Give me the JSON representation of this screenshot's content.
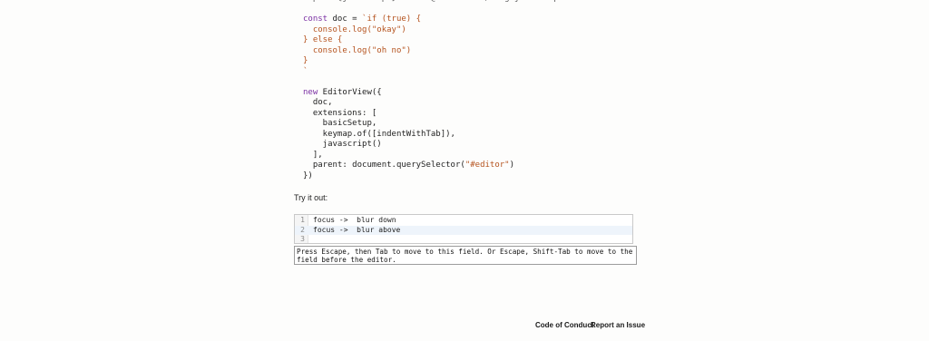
{
  "code_lines": [
    {
      "segments": [
        {
          "t": "import {javascript} from \"@codemirror/lang-javascript\"",
          "c": "cut"
        }
      ]
    },
    {
      "segments": [
        {
          "t": "",
          "c": ""
        }
      ]
    },
    {
      "segments": [
        {
          "t": "const",
          "c": "kw"
        },
        {
          "t": " doc = ",
          "c": ""
        },
        {
          "t": "`if (true) {",
          "c": "str"
        }
      ]
    },
    {
      "segments": [
        {
          "t": "  console.log(\"okay\")",
          "c": "str"
        }
      ]
    },
    {
      "segments": [
        {
          "t": "} else {",
          "c": "str"
        }
      ]
    },
    {
      "segments": [
        {
          "t": "  console.log(\"oh no\")",
          "c": "str"
        }
      ]
    },
    {
      "segments": [
        {
          "t": "}",
          "c": "str"
        }
      ]
    },
    {
      "segments": [
        {
          "t": "`",
          "c": "str"
        }
      ]
    },
    {
      "segments": [
        {
          "t": "",
          "c": ""
        }
      ]
    },
    {
      "segments": [
        {
          "t": "new",
          "c": "kw"
        },
        {
          "t": " EditorView({",
          "c": ""
        }
      ]
    },
    {
      "segments": [
        {
          "t": "  doc,",
          "c": ""
        }
      ]
    },
    {
      "segments": [
        {
          "t": "  extensions: [",
          "c": ""
        }
      ]
    },
    {
      "segments": [
        {
          "t": "    basicSetup,",
          "c": ""
        }
      ]
    },
    {
      "segments": [
        {
          "t": "    keymap.of([indentWithTab]),",
          "c": ""
        }
      ]
    },
    {
      "segments": [
        {
          "t": "    javascript()",
          "c": ""
        }
      ]
    },
    {
      "segments": [
        {
          "t": "  ],",
          "c": ""
        }
      ]
    },
    {
      "segments": [
        {
          "t": "  parent: document.querySelector(",
          "c": ""
        },
        {
          "t": "\"#editor\"",
          "c": "str"
        },
        {
          "t": ")",
          "c": ""
        }
      ]
    },
    {
      "segments": [
        {
          "t": "})",
          "c": ""
        }
      ]
    }
  ],
  "try_label": "Try it out:",
  "editor": {
    "lines": [
      {
        "num": "1",
        "text": "focus ->  blur down",
        "active": false
      },
      {
        "num": "2",
        "text": "focus ->  blur above",
        "active": true
      },
      {
        "num": "3",
        "text": "",
        "active": false
      }
    ]
  },
  "notice": "Press Escape, then Tab to move to this field. Or Escape, Shift-Tab to move to the field before the editor.",
  "footer": {
    "code_of_conduct": "Code of Conduct",
    "report_issue": "Report an Issue"
  }
}
